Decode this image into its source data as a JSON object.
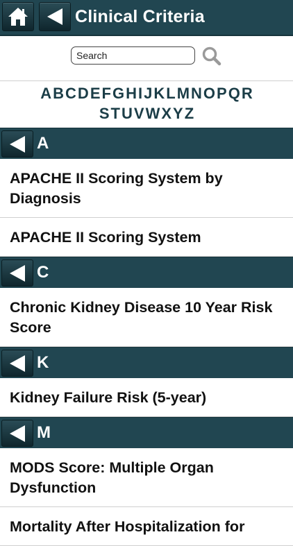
{
  "header": {
    "title": "Clinical Criteria",
    "home_icon": "home-icon",
    "back_icon": "back-arrow-icon"
  },
  "search": {
    "placeholder": "Search",
    "icon": "magnifier-icon"
  },
  "alphabet": {
    "row1": [
      "A",
      "B",
      "C",
      "D",
      "E",
      "F",
      "G",
      "H",
      "I",
      "J",
      "K",
      "L",
      "M",
      "N",
      "O",
      "P",
      "Q",
      "R"
    ],
    "row2": [
      "S",
      "T",
      "U",
      "V",
      "W",
      "X",
      "Y",
      "Z"
    ]
  },
  "sections": [
    {
      "letter": "A",
      "items": [
        "APACHE II Scoring System by Diagnosis",
        "APACHE II Scoring System"
      ]
    },
    {
      "letter": "C",
      "items": [
        "Chronic Kidney Disease 10 Year Risk Score"
      ]
    },
    {
      "letter": "K",
      "items": [
        "Kidney Failure Risk (5-year)"
      ]
    },
    {
      "letter": "M",
      "items": [
        "MODS Score: Multiple Organ Dysfunction",
        "Mortality After Hospitalization for"
      ]
    }
  ],
  "colors": {
    "bar": "#214651",
    "alphabet": "#1b3d47"
  }
}
